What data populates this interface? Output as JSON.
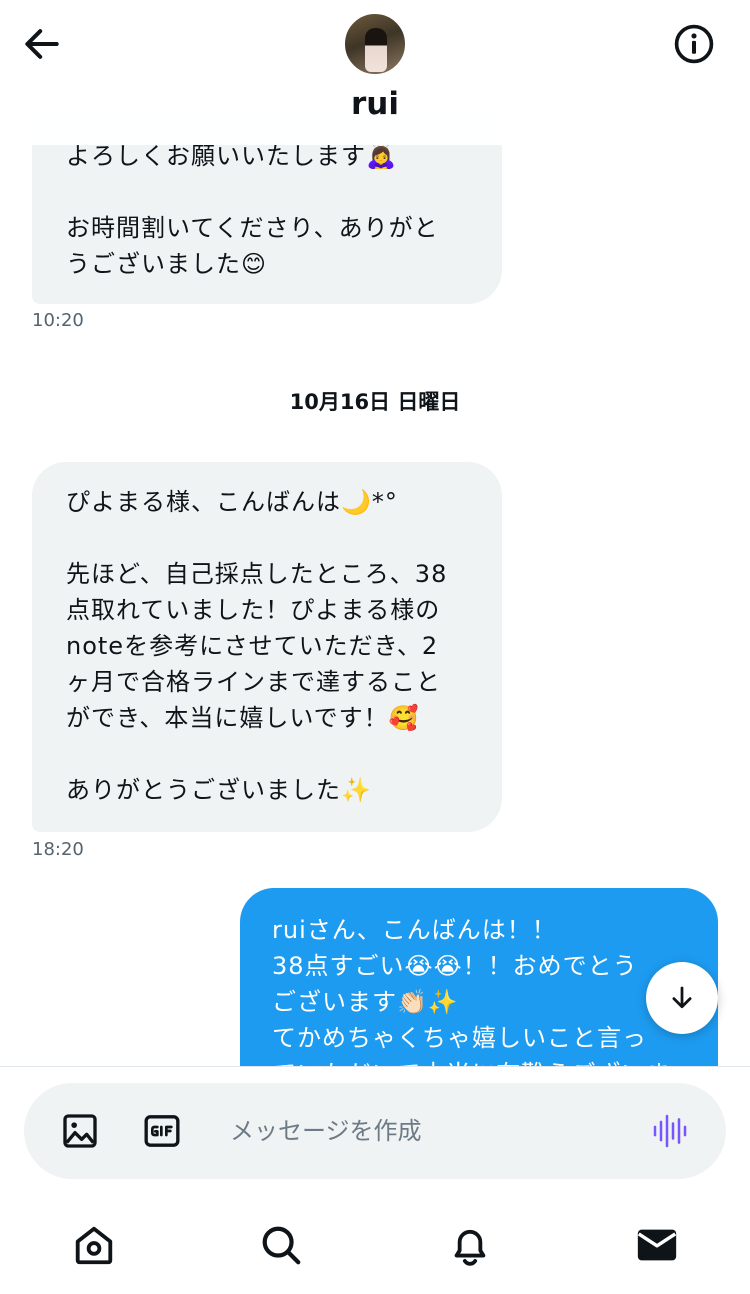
{
  "header": {
    "name": "rui",
    "back_icon": "arrow-left-icon",
    "info_icon": "info-circle-icon"
  },
  "messages": [
    {
      "direction": "received",
      "text": "よろしくお願いいたします🙇‍♀️\n\nお時間割いてくださり、ありがと\nうございました😊",
      "time": "10:20"
    },
    {
      "direction": "received",
      "text": "ぴよまる様、こんばんは🌙*°\n\n先ほど、自己採点したところ、38\n点取れていました！ぴよまる様の\nnoteを参考にさせていただき、2\nヶ月で合格ラインまで達すること\nができ、本当に嬉しいです！🥰\n\nありがとうございました✨",
      "time": "18:20"
    },
    {
      "direction": "sent",
      "text": "ruiさん、こんばんは！！\n38点すごい😭😭！！おめでとう\nございます👏🏻✨\nてかめちゃくちゃ嬉しいこと言っ\nていただいて本当に有難うございます"
    }
  ],
  "date_separator": "10月16日 日曜日",
  "composer": {
    "placeholder": "メッセージを作成",
    "value": ""
  },
  "colors": {
    "sent_bubble": "#1d9bf0",
    "received_bubble": "#eff3f4",
    "voice_accent": "#7856ff"
  },
  "nav": {
    "items": [
      "home-icon",
      "search-icon",
      "bell-icon",
      "mail-icon"
    ],
    "active": "mail-icon"
  }
}
